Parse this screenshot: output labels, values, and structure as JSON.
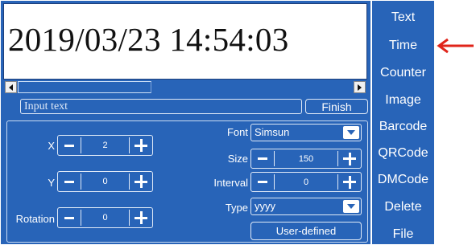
{
  "preview": {
    "datetime_text": "2019/03/23 14:54:03"
  },
  "input": {
    "placeholder": "Input text",
    "value": ""
  },
  "buttons": {
    "finish": "Finish",
    "user_defined": "User-defined"
  },
  "left_fields": {
    "x": {
      "label": "X",
      "value": "2"
    },
    "y": {
      "label": "Y",
      "value": "0"
    },
    "rotation": {
      "label": "Rotation",
      "value": "0"
    }
  },
  "right_fields": {
    "font": {
      "label": "Font",
      "value": "Simsun"
    },
    "size": {
      "label": "Size",
      "value": "150"
    },
    "interval": {
      "label": "Interval",
      "value": "0"
    },
    "type": {
      "label": "Type",
      "value": "yyyy"
    }
  },
  "sidebar": {
    "items": [
      {
        "label": "Text"
      },
      {
        "label": "Time"
      },
      {
        "label": "Counter"
      },
      {
        "label": "Image"
      },
      {
        "label": "Barcode"
      },
      {
        "label": "QRCode"
      },
      {
        "label": "DMCode"
      },
      {
        "label": "Delete"
      },
      {
        "label": "File"
      }
    ],
    "selected": "Time"
  },
  "icons": {
    "indicator": "red-arrow-left-icon",
    "scroll_left": "scroll-left-icon",
    "scroll_right": "scroll-right-icon",
    "minus": "minus-icon",
    "plus": "plus-icon",
    "dropdown": "chevron-down-icon"
  },
  "colors": {
    "panel_blue": "#2864b8",
    "border_light": "#dfe9f7",
    "indicator_red": "#e0241a"
  }
}
